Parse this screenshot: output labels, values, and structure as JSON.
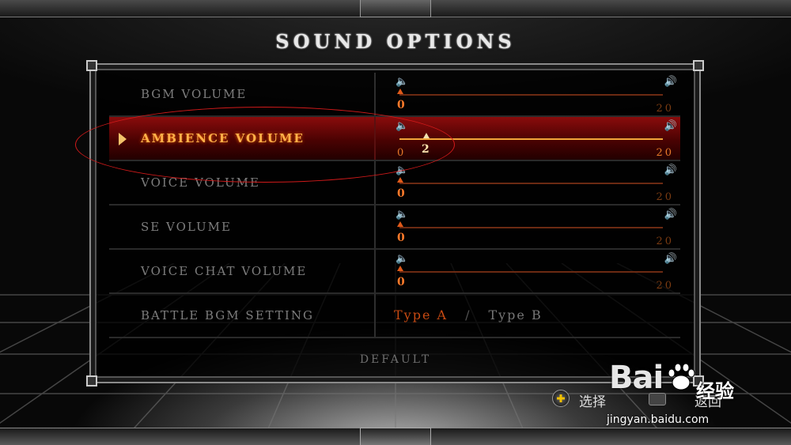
{
  "screen": {
    "title": "SOUND OPTIONS"
  },
  "rows": [
    {
      "label": "BGM VOLUME",
      "type": "slider",
      "value": "0",
      "min": "0",
      "max": "20"
    },
    {
      "label": "AMBIENCE VOLUME",
      "type": "slider",
      "value": "2",
      "min": "0",
      "max": "20",
      "selected": true
    },
    {
      "label": "VOICE VOLUME",
      "type": "slider",
      "value": "0",
      "min": "0",
      "max": "20"
    },
    {
      "label": "SE VOLUME",
      "type": "slider",
      "value": "0",
      "min": "0",
      "max": "20"
    },
    {
      "label": "VOICE CHAT VOLUME",
      "type": "slider",
      "value": "0",
      "min": "0",
      "max": "20"
    },
    {
      "label": "BATTLE BGM SETTING",
      "type": "choice",
      "option_a": "Type A",
      "separator": "/",
      "option_b": "Type B",
      "selected_option": "Type A"
    }
  ],
  "default_label": "DEFAULT",
  "hints": {
    "select": "选择",
    "back": "返回"
  },
  "watermark": {
    "brand": "Bai",
    "brand_cn": "经验",
    "url": "jingyan.baidu.com"
  },
  "colors": {
    "accent": "#ff7a2a",
    "selected_row": "#8a0c0c",
    "annotation": "#d21a1a"
  }
}
